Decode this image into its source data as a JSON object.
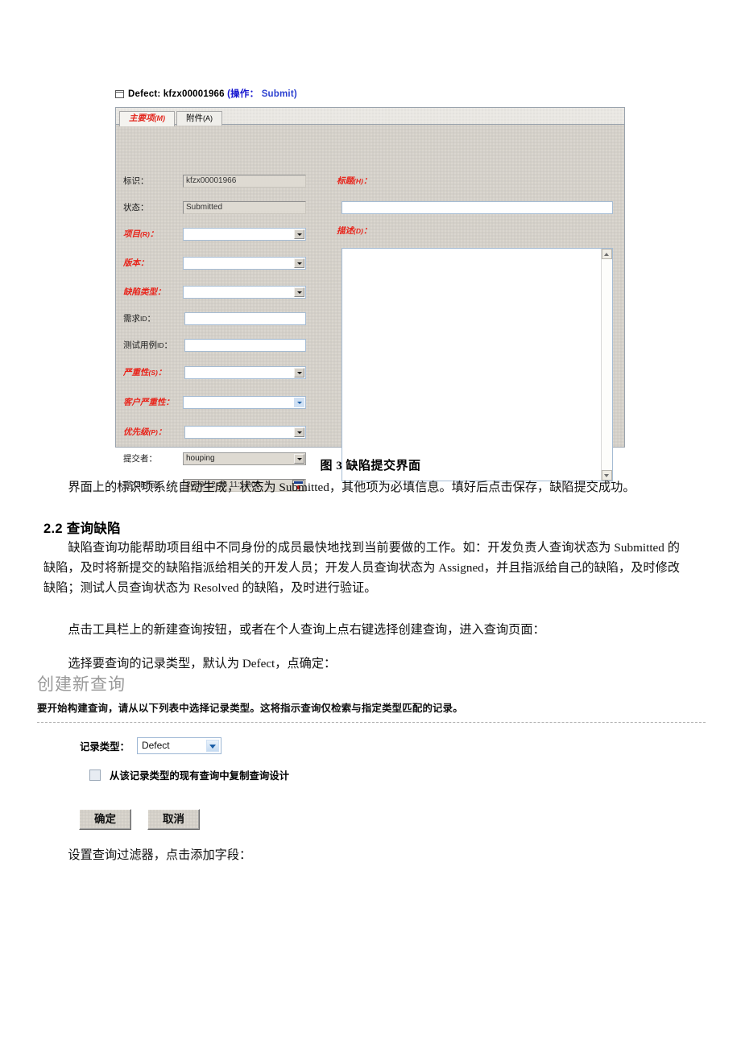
{
  "figure1": {
    "window_title_prefix": "Defect:",
    "record_id": "kfzx00001966",
    "operation_label": "(操作：",
    "operation_value": "Submit)",
    "tabs": [
      {
        "label": "主要项",
        "mnemonic": "(M)",
        "active": true
      },
      {
        "label": "附件",
        "mnemonic": "(A)",
        "active": false
      }
    ],
    "fields": [
      {
        "label": "标识",
        "mnemonic": "",
        "required": false,
        "type": "readonly",
        "value": "kfzx00001966"
      },
      {
        "label": "状态",
        "mnemonic": "",
        "required": false,
        "type": "readonly",
        "value": "Submitted"
      },
      {
        "label": "项目",
        "mnemonic": "(R)",
        "required": true,
        "type": "combo",
        "value": ""
      },
      {
        "label": "版本",
        "mnemonic": "",
        "required": true,
        "type": "combo",
        "value": ""
      },
      {
        "label": "缺陷类型",
        "mnemonic": "",
        "required": true,
        "type": "combo",
        "value": ""
      },
      {
        "label": "需求",
        "mnemonic": "ID",
        "required": false,
        "type": "text",
        "value": ""
      },
      {
        "label": "测试用例",
        "mnemonic": "ID",
        "required": false,
        "type": "text",
        "value": ""
      },
      {
        "label": "严重性",
        "mnemonic": "(S)",
        "required": true,
        "type": "combo",
        "value": ""
      },
      {
        "label": "客户严重性",
        "mnemonic": "",
        "required": true,
        "type": "combo-blue",
        "value": ""
      },
      {
        "label": "优先级",
        "mnemonic": "(P)",
        "required": true,
        "type": "combo",
        "value": ""
      },
      {
        "label": "提交者",
        "mnemonic": "",
        "required": false,
        "type": "combo-grey",
        "value": "houping"
      },
      {
        "label": "提交时间",
        "mnemonic": "",
        "required": false,
        "type": "datetime",
        "value": "2009-12-16 11:12:05"
      }
    ],
    "right_fields": [
      {
        "label": "标题",
        "mnemonic": "(H)",
        "required": true,
        "type": "text",
        "value": ""
      },
      {
        "label": "描述",
        "mnemonic": "(D)",
        "required": true,
        "type": "textarea",
        "value": ""
      }
    ]
  },
  "figure1_caption": "图 3  缺陷提交界面",
  "body": {
    "para1": "界面上的标识项系统自动生成，状态为 Submitted，其他项为必填信息。填好后点击保存，缺陷提交成功。",
    "heading2": "2.2 查询缺陷",
    "para2": "缺陷查询功能帮助项目组中不同身份的成员最快地找到当前要做的工作。如：开发负责人查询状态为 Submitted 的缺陷，及时将新提交的缺陷指派给相关的开发人员；开发人员查询状态为 Assigned，并且指派给自己的缺陷，及时修改缺陷；测试人员查询状态为 Resolved 的缺陷，及时进行验证。",
    "para3": "点击工具栏上的新建查询按钮，或者在个人查询上点右键选择创建查询，进入查询页面：",
    "para4": "选择要查询的记录类型，默认为 Defect，点确定：",
    "para5": "设置查询过滤器，点击添加字段："
  },
  "figure2": {
    "title": "创建新查询",
    "description": "要开始构建查询，请从以下列表中选择记录类型。这将指示查询仅检索与指定类型匹配的记录。",
    "record_type_label": "记录类型：",
    "record_type_value": "Defect",
    "copy_checkbox_label": "从该记录类型的现有查询中复制查询设计",
    "ok_button": "确定",
    "cancel_button": "取消"
  },
  "colors": {
    "required_red": "#e8241b",
    "link_blue": "#2a3fd0",
    "panel_grey": "#d4d0c8",
    "heading_grey": "#9a9a9a"
  }
}
